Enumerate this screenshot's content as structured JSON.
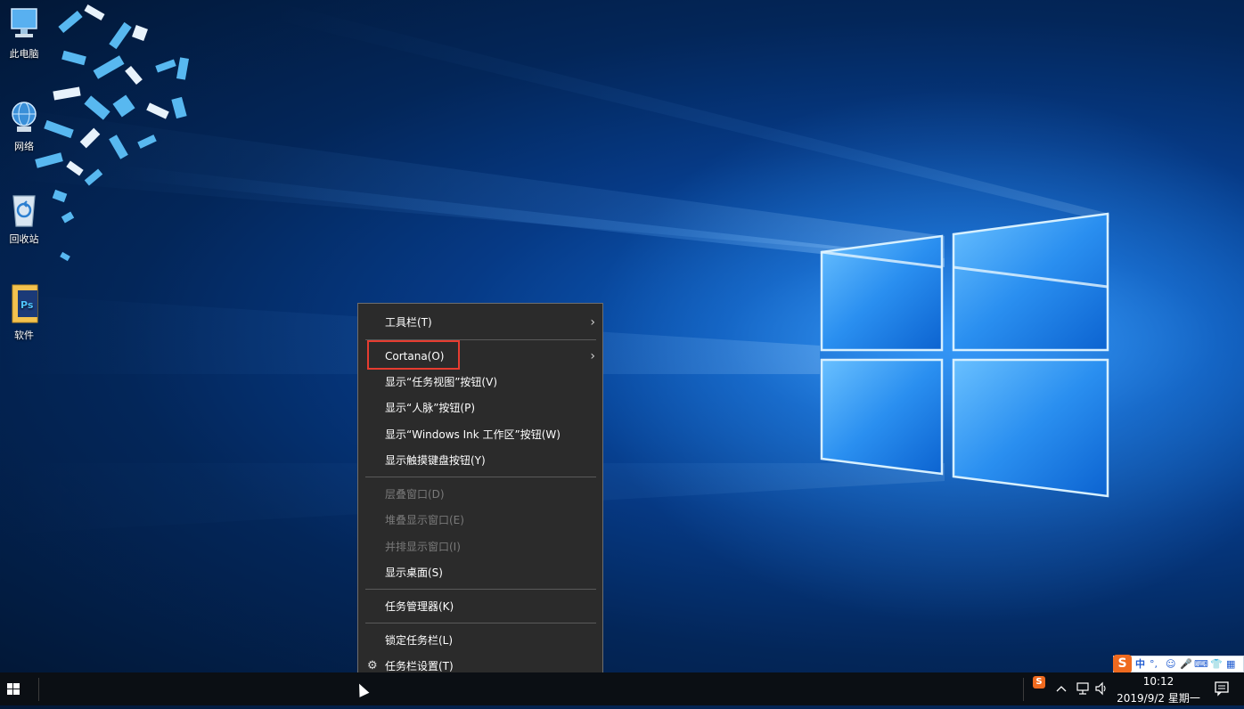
{
  "desktop": {
    "icons": [
      {
        "label": "此电脑",
        "icon": "computer-icon"
      },
      {
        "label": "网络",
        "icon": "network-icon"
      },
      {
        "label": "回收站",
        "icon": "recycle-bin-icon"
      },
      {
        "label": "软件",
        "icon": "folder-icon"
      }
    ]
  },
  "context_menu": {
    "items": [
      {
        "label": "工具栏(T)",
        "submenu": true,
        "disabled": false
      },
      {
        "label": "Cortana(O)",
        "submenu": true,
        "disabled": false,
        "highlighted": true
      },
      {
        "label": "显示“任务视图”按钮(V)",
        "disabled": false
      },
      {
        "label": "显示“人脉”按钮(P)",
        "disabled": false
      },
      {
        "label": "显示“Windows Ink 工作区”按钮(W)",
        "disabled": false
      },
      {
        "label": "显示触摸键盘按钮(Y)",
        "disabled": false
      },
      {
        "label": "层叠窗口(D)",
        "disabled": true
      },
      {
        "label": "堆叠显示窗口(E)",
        "disabled": true
      },
      {
        "label": "并排显示窗口(I)",
        "disabled": true
      },
      {
        "label": "显示桌面(S)",
        "disabled": false
      },
      {
        "label": "任务管理器(K)",
        "disabled": false
      },
      {
        "label": "锁定任务栏(L)",
        "disabled": false
      },
      {
        "label": "任务栏设置(T)",
        "disabled": false,
        "icon": "gear-icon"
      }
    ],
    "submenu_glyph": "›",
    "highlight_color": "#e63c30"
  },
  "ime": {
    "logo": "S",
    "mode": "中",
    "punct": "°,",
    "items": [
      "☺",
      "🎤",
      "⌨",
      "👕",
      "▦"
    ]
  },
  "taskbar": {
    "time": "10:12",
    "date": "2019/9/2 星期一",
    "tray_app_logo": "S",
    "colors": {
      "bar": "#0b0f14",
      "text": "#ffffff"
    }
  }
}
